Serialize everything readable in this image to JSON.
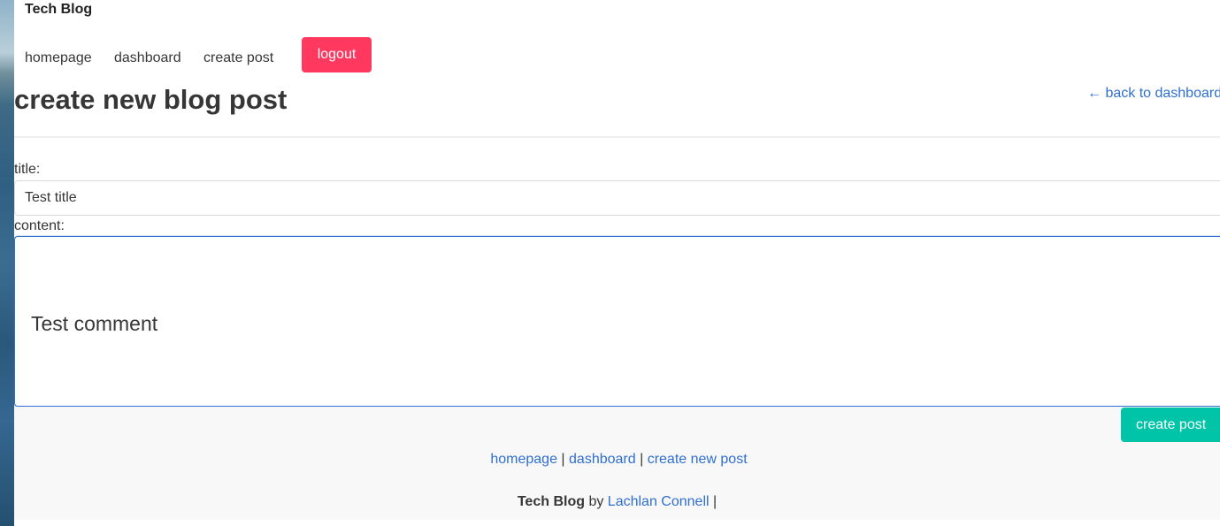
{
  "header": {
    "brand": "Tech Blog",
    "nav": {
      "homepage": "homepage",
      "dashboard": "dashboard",
      "create_post": "create post",
      "logout": "logout"
    }
  },
  "main": {
    "page_title": "create new blog post",
    "back_link": "← back to dashboard",
    "form": {
      "title_label": "title:",
      "title_value": "Test title",
      "content_label": "content:",
      "content_value": "Test comment",
      "submit_label": "create post"
    }
  },
  "footer": {
    "links": {
      "homepage": "homepage",
      "separator1": " | ",
      "dashboard": "dashboard",
      "separator2": " | ",
      "create_new_post": "create new post"
    },
    "credit": {
      "brand": "Tech Blog",
      "by": " by ",
      "author": "Lachlan Connell",
      "trailing": " |"
    }
  },
  "colors": {
    "logout_button": "#ff3860",
    "submit_button": "#00c4a7",
    "link": "#2f6fd1",
    "focus_border": "#2f6fd1",
    "footer_bg": "#f8f8f8"
  }
}
